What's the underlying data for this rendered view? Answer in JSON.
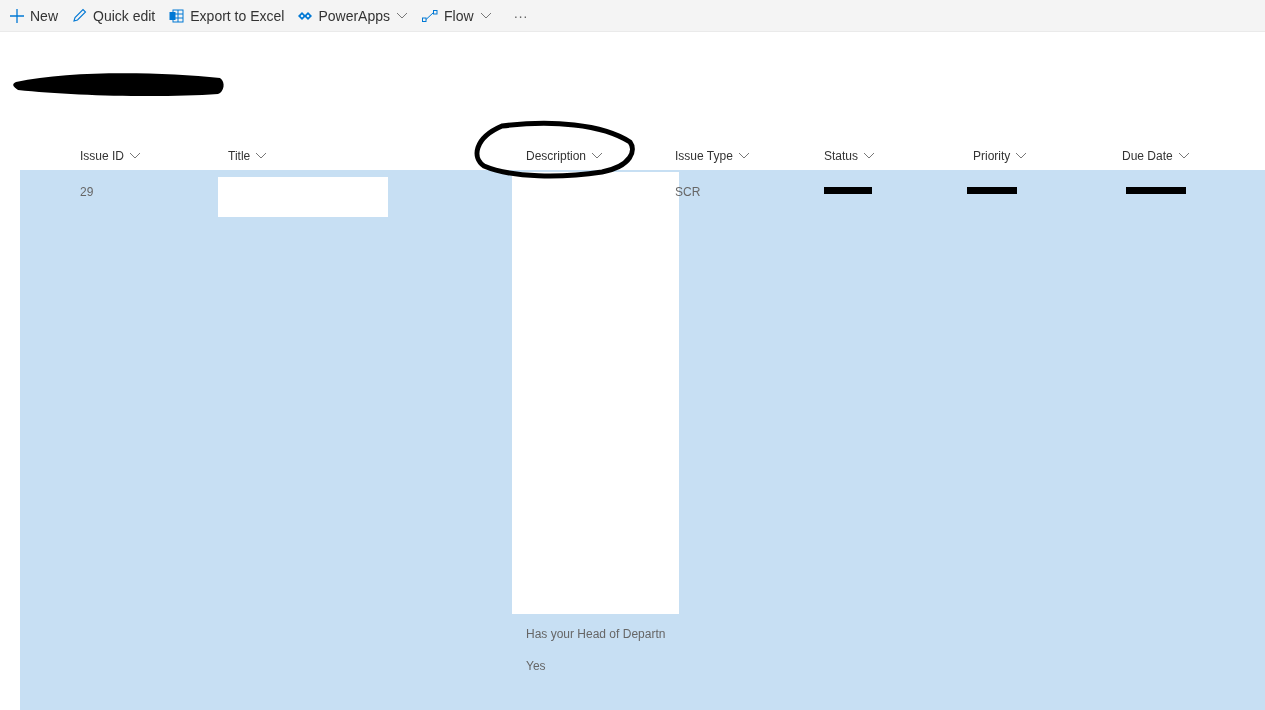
{
  "toolbar": [
    {
      "kind": "plus",
      "label": "New",
      "caret": false
    },
    {
      "kind": "pencil",
      "label": "Quick edit",
      "caret": false
    },
    {
      "kind": "excel",
      "label": "Export to Excel",
      "caret": false
    },
    {
      "kind": "apps",
      "label": "PowerApps",
      "caret": true
    },
    {
      "kind": "flow",
      "label": "Flow",
      "caret": true
    },
    {
      "kind": "more",
      "label": "···",
      "caret": false
    }
  ],
  "table": {
    "columns": [
      {
        "label": "Issue ID",
        "circled": false
      },
      {
        "label": "Title",
        "circled": false
      },
      {
        "label": "Description",
        "circled": true
      },
      {
        "label": "Issue Type",
        "circled": false
      },
      {
        "label": "Status",
        "circled": false
      },
      {
        "label": "Priority",
        "circled": false
      },
      {
        "label": "Due Date",
        "circled": false
      }
    ],
    "rows": [
      {
        "selected": true,
        "issue_id": "29",
        "description_lines": [
          "Has your Head of Departn",
          "Yes"
        ],
        "issue_type": "SCR"
      }
    ]
  }
}
